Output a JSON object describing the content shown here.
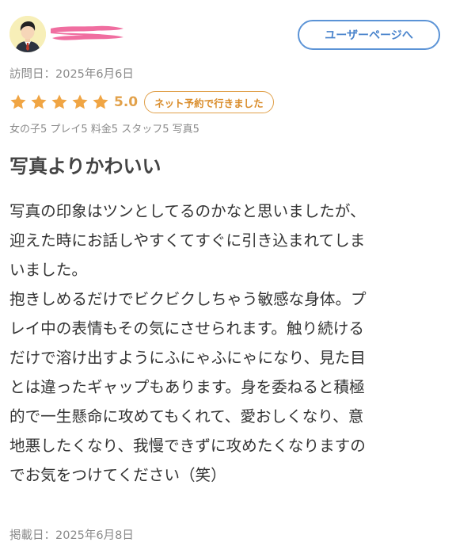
{
  "header": {
    "user_page_button": "ユーザーページへ"
  },
  "visit": {
    "label": "訪問日：2025年6月6日"
  },
  "rating": {
    "stars": 5,
    "max_stars": 5,
    "score": "5.0",
    "visit_type": "ネット予約で行きました",
    "star_color": "#f0a544"
  },
  "sub_ratings": "女の子5 プレイ5 料金5 スタッフ5 写真5",
  "review": {
    "title": "写真よりかわいい",
    "lines": [
      "写真の印象はツンとしてるのかなと思いましたが、",
      "迎えた時にお話しやすくてすぐに引き込まれてしま",
      "いました。",
      "抱きしめるだけでビクビクしちゃう敏感な身体。プ",
      "レイ中の表情もその気にさせられます。触り続ける",
      "だけで溶け出すようにふにゃふにゃになり、見た目",
      "とは違ったギャップもあります。身を委ねると積極",
      "的で一生懸命に攻めてもくれて、愛おしくなり、意",
      "地悪したくなり、我慢できずに攻めたくなりますの",
      "でお気をつけてください（笑）"
    ]
  },
  "posted": {
    "label": "掲載日：2025年6月8日"
  },
  "colors": {
    "accent_blue": "#5b93d6",
    "accent_orange": "#e0a04a",
    "redaction_pink": "#f06ea0"
  }
}
